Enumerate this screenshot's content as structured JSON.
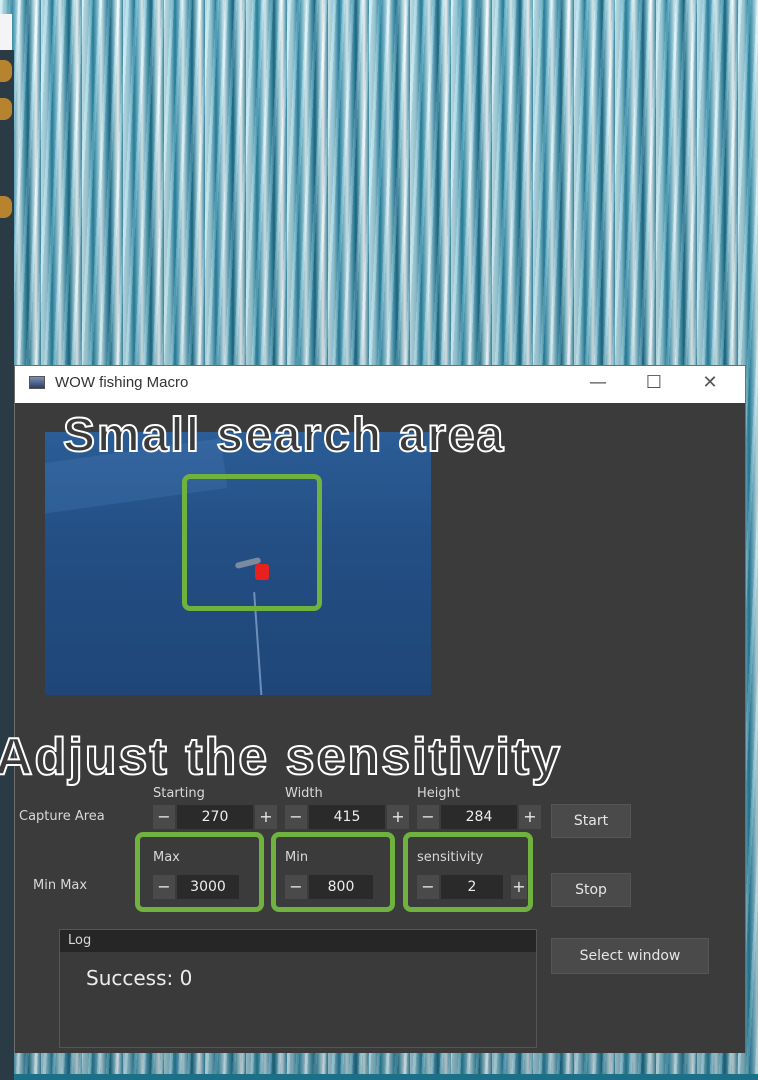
{
  "window": {
    "title": "WOW fishing Macro",
    "minimize_glyph": "—",
    "maximize_glyph": "☐",
    "close_glyph": "✕"
  },
  "overlay": {
    "top_caption": "Small search area",
    "mid_caption": "Adjust the sensitivity"
  },
  "capture_area": {
    "row_label": "Capture Area",
    "starting": {
      "label": "Starting",
      "value": "270"
    },
    "width": {
      "label": "Width",
      "value": "415"
    },
    "height": {
      "label": "Height",
      "value": "284"
    }
  },
  "min_max": {
    "row_label": "Min Max",
    "max": {
      "label": "Max",
      "value": "3000"
    },
    "min": {
      "label": "Min",
      "value": "800"
    },
    "sensitivity": {
      "label": "sensitivity",
      "value": "2"
    }
  },
  "spinner": {
    "minus": "−",
    "plus": "+"
  },
  "buttons": {
    "start": "Start",
    "stop": "Stop",
    "select_window": "Select window"
  },
  "log": {
    "title": "Log",
    "text": "Success: 0"
  },
  "colors": {
    "highlight": "#6fb23f",
    "window_bg": "#3b3b3b",
    "bobber": "#e8201e"
  }
}
